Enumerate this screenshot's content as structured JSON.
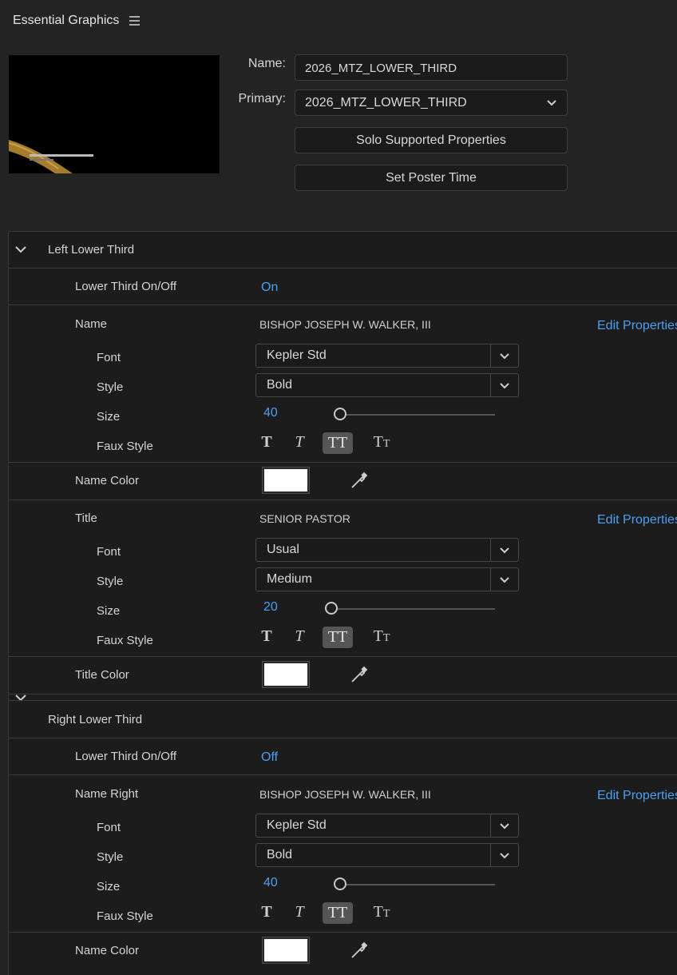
{
  "app": {
    "title": "Essential Graphics"
  },
  "template": {
    "name_label": "Name:",
    "name_value": "2026_MTZ_LOWER_THIRD",
    "primary_label": "Primary:",
    "primary_value": "2026_MTZ_LOWER_THIRD",
    "solo_button": "Solo Supported Properties",
    "poster_button": "Set Poster Time"
  },
  "left": {
    "group_title": "Left Lower Third",
    "onoff_label": "Lower Third On/Off",
    "onoff_value": "On",
    "name_label": "Name",
    "name_text": "BISHOP JOSEPH W. WALKER, III",
    "edit_props": "Edit Properties",
    "name_font_label": "Font",
    "name_font": "Kepler Std",
    "name_style_label": "Style",
    "name_style": "Bold",
    "name_size_label": "Size",
    "name_size": "40",
    "name_faux_label": "Faux Style",
    "name_color_label": "Name Color",
    "title_label": "Title",
    "title_text": "SENIOR PASTOR",
    "title_font_label": "Font",
    "title_font": "Usual",
    "title_style_label": "Style",
    "title_style": "Medium",
    "title_size_label": "Size",
    "title_size": "20",
    "title_faux_label": "Faux Style",
    "title_color_label": "Title Color"
  },
  "right": {
    "group_title": "Right Lower Third",
    "onoff_label": "Lower Third On/Off",
    "onoff_value": "Off",
    "name_label": "Name Right",
    "name_text": "BISHOP JOSEPH W. WALKER, III",
    "edit_props": "Edit Properties",
    "font_label": "Font",
    "font": "Kepler Std",
    "style_label": "Style",
    "style": "Bold",
    "size_label": "Size",
    "size": "40",
    "faux_label": "Faux Style",
    "color_label": "Name Color"
  },
  "colors": {
    "accent": "#4b9ff2",
    "swatch": "#ffffff",
    "preview_bar": "#b0842f"
  },
  "icons": [
    "menu-icon",
    "chevron-down-icon",
    "eyedropper-icon",
    "faux-bold-icon",
    "faux-italic-icon",
    "all-caps-icon",
    "small-caps-icon"
  ]
}
